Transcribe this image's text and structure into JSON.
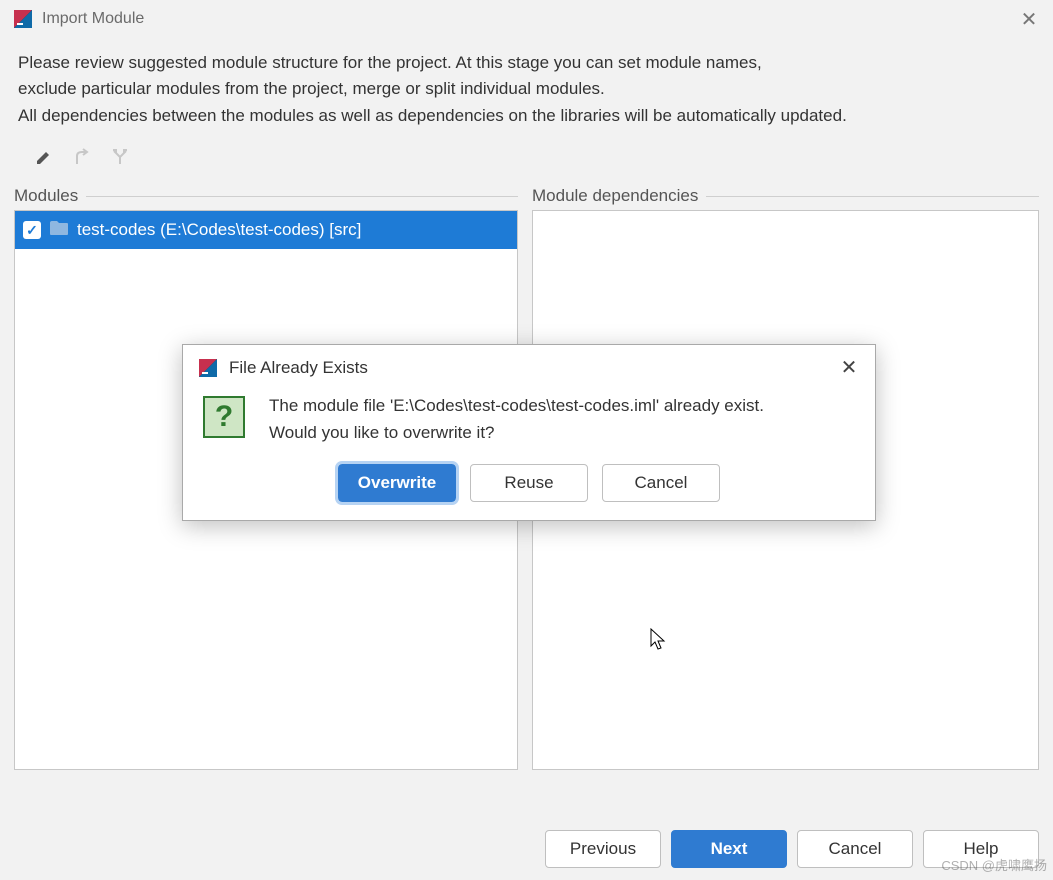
{
  "window": {
    "title": "Import Module"
  },
  "instructions": {
    "line1": "Please review suggested module structure for the project. At this stage you can set module names,",
    "line2": "exclude particular modules from the project, merge or split individual modules.",
    "line3": "All dependencies between the modules as well as dependencies on the libraries will be automatically updated."
  },
  "panels": {
    "modules_label": "Modules",
    "dependencies_label": "Module dependencies"
  },
  "modules": [
    {
      "checked": true,
      "label": "test-codes (E:\\Codes\\test-codes) [src]"
    }
  ],
  "footer": {
    "previous": "Previous",
    "next": "Next",
    "cancel": "Cancel",
    "help": "Help"
  },
  "dialog": {
    "title": "File Already Exists",
    "message_line1": "The module file 'E:\\Codes\\test-codes\\test-codes.iml' already exist.",
    "message_line2": "Would you like to overwrite it?",
    "overwrite": "Overwrite",
    "reuse": "Reuse",
    "cancel": "Cancel"
  },
  "watermark": "CSDN @虎啸鹰扬"
}
